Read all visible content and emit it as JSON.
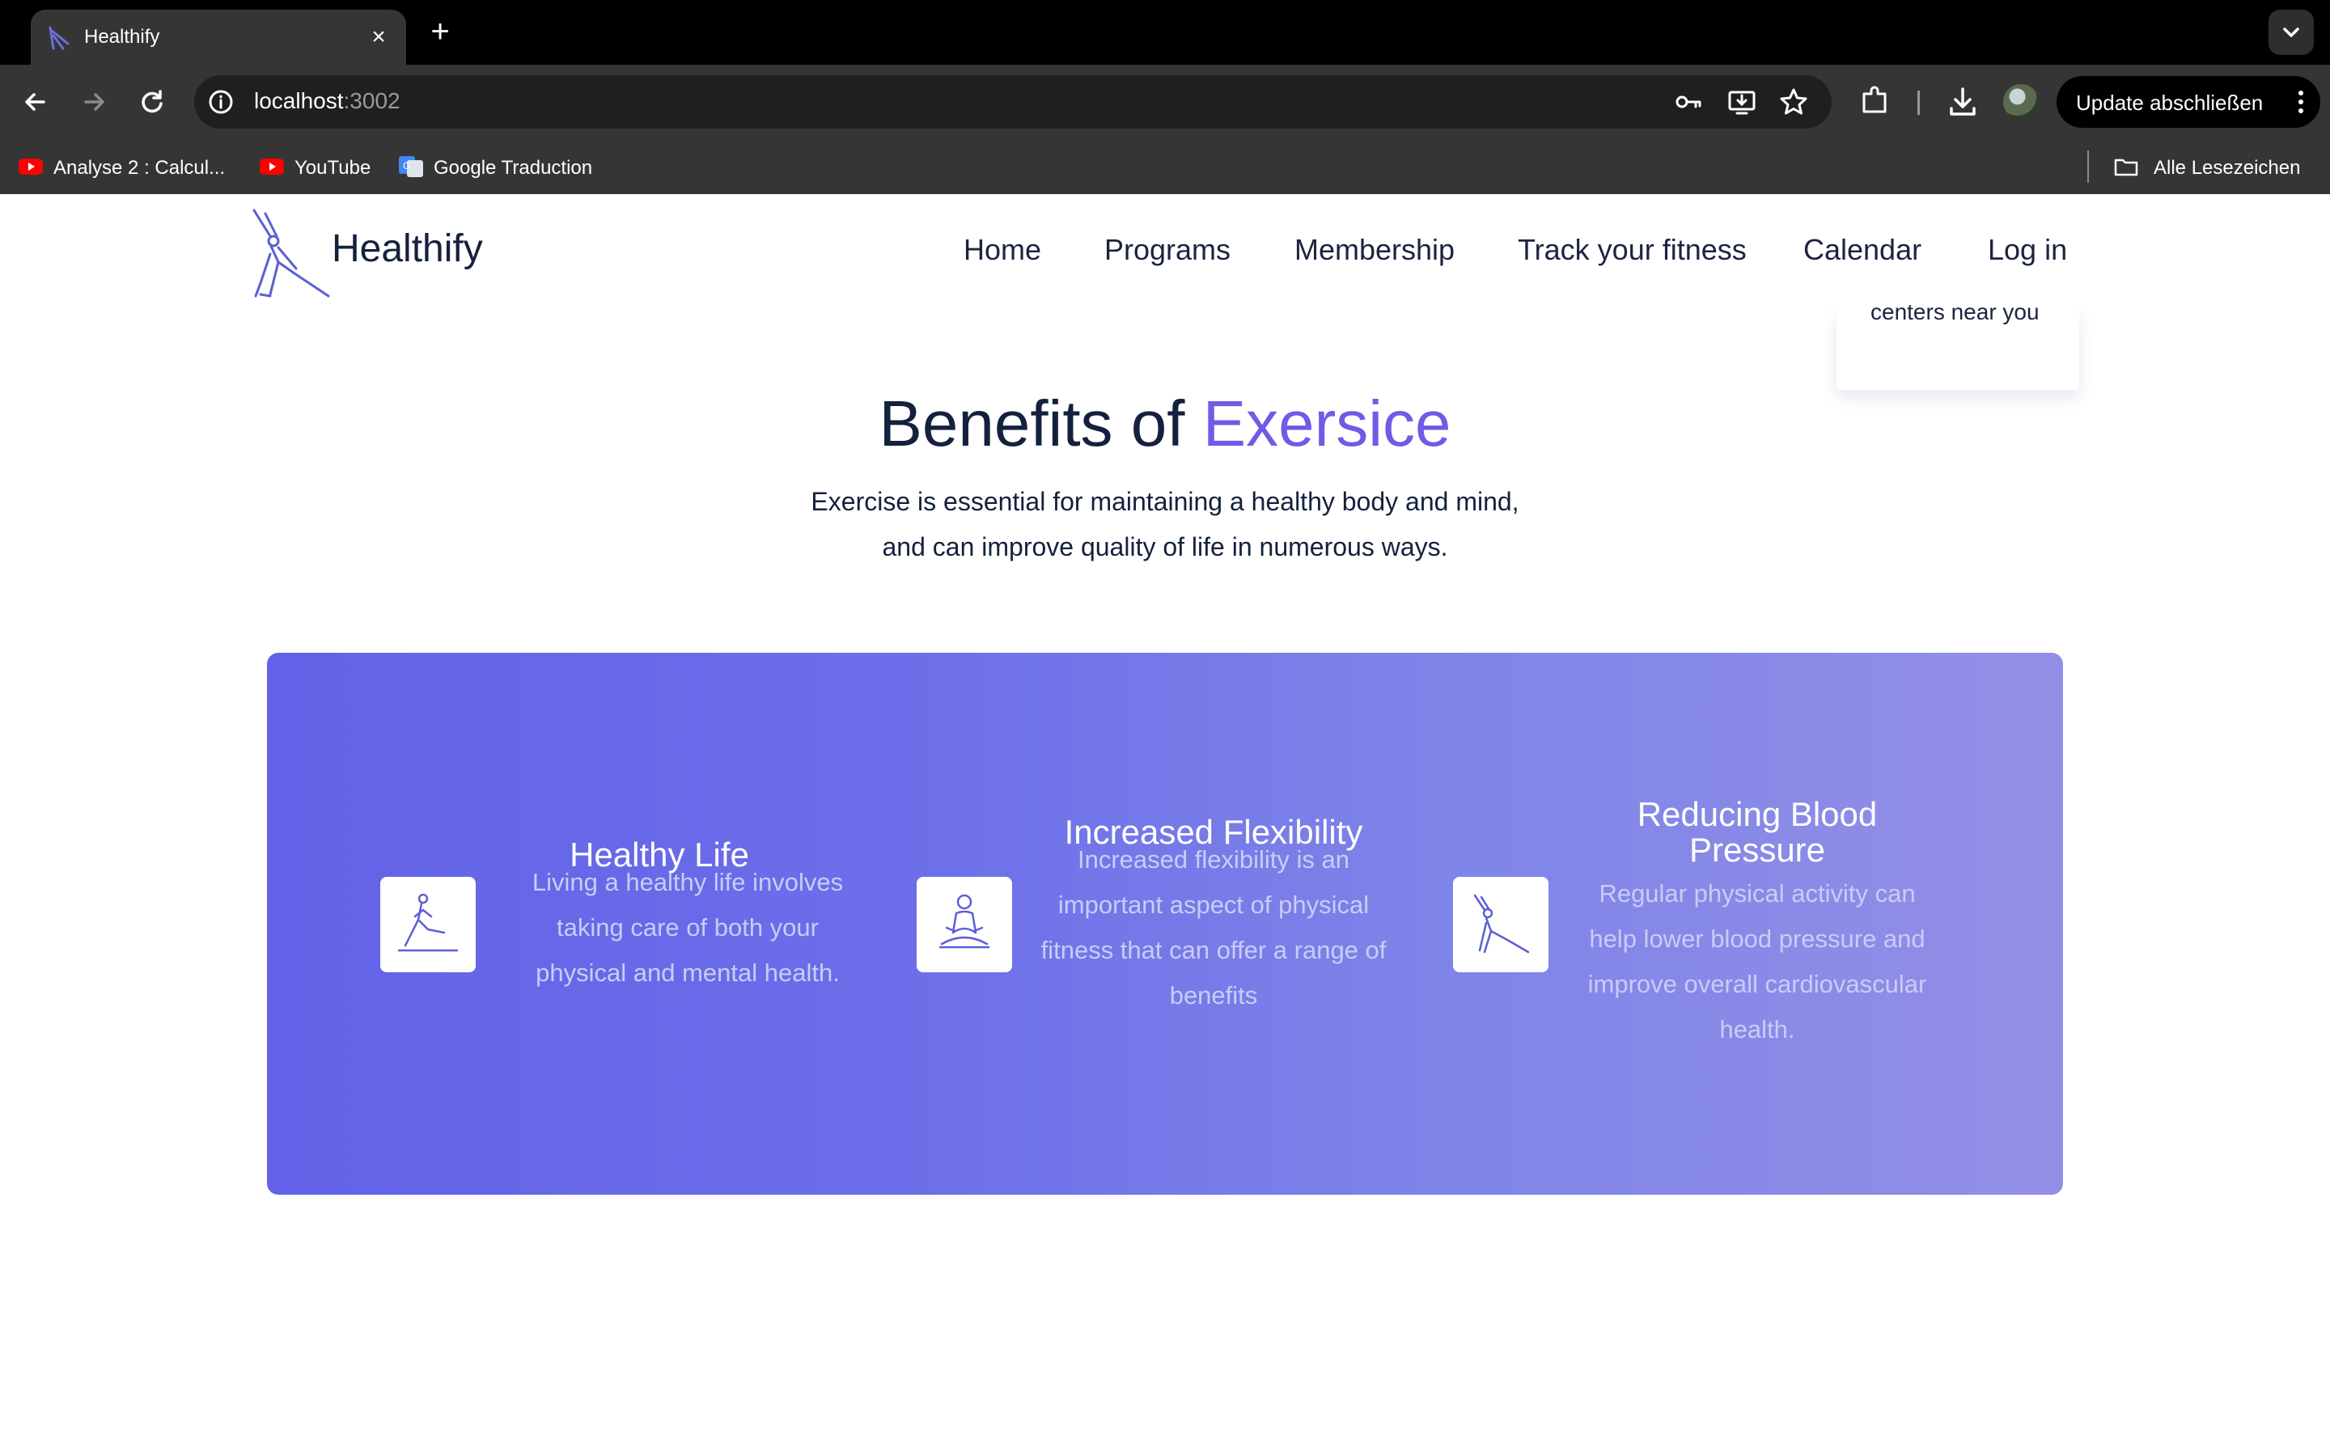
{
  "browser": {
    "tab": {
      "title": "Healthify",
      "favicon": "healthify-logo-icon"
    },
    "address": {
      "host": "localhost",
      "port": ":3002"
    },
    "update_button": "Update abschließen",
    "bookmarks": [
      {
        "label": "Analyse 2 : Calcul...",
        "icon": "youtube-icon"
      },
      {
        "label": "YouTube",
        "icon": "youtube-icon"
      },
      {
        "label": "Google Traduction",
        "icon": "google-translate-icon"
      }
    ],
    "all_bookmarks": "Alle Lesezeichen"
  },
  "site": {
    "brand": "Healthify",
    "nav": [
      "Home",
      "Programs",
      "Membership",
      "Track your fitness",
      "Calendar",
      "Log in"
    ],
    "dropdown_text": "centers near you"
  },
  "benefits": {
    "title_main": "Benefits of",
    "title_accent": "Exersice",
    "subtitle_line1": "Exercise is essential for maintaining a healthy body and mind,",
    "subtitle_line2": "and can improve quality of life in numerous ways.",
    "items": [
      {
        "title": "Healthy Life",
        "text": [
          "Living a healthy life involves",
          "taking care of both your",
          "physical and mental health."
        ],
        "icon": "lunge-exercise-icon"
      },
      {
        "title": "Increased Flexibility",
        "text": [
          "Increased flexibility is an",
          "important aspect of physical",
          "fitness that can offer a range of",
          "benefits"
        ],
        "icon": "meditation-icon"
      },
      {
        "title": "Reducing Blood Pressure",
        "title_lines": [
          "Reducing Blood",
          "Pressure"
        ],
        "text": [
          "Regular physical activity can",
          "help lower blood pressure and",
          "improve overall cardiovascular",
          "health."
        ],
        "icon": "side-stretch-icon"
      }
    ]
  },
  "colors": {
    "accent": "#6e5ce6",
    "panel_start": "#6362e8",
    "panel_end": "#938fe6",
    "text_dark": "#14213d"
  }
}
